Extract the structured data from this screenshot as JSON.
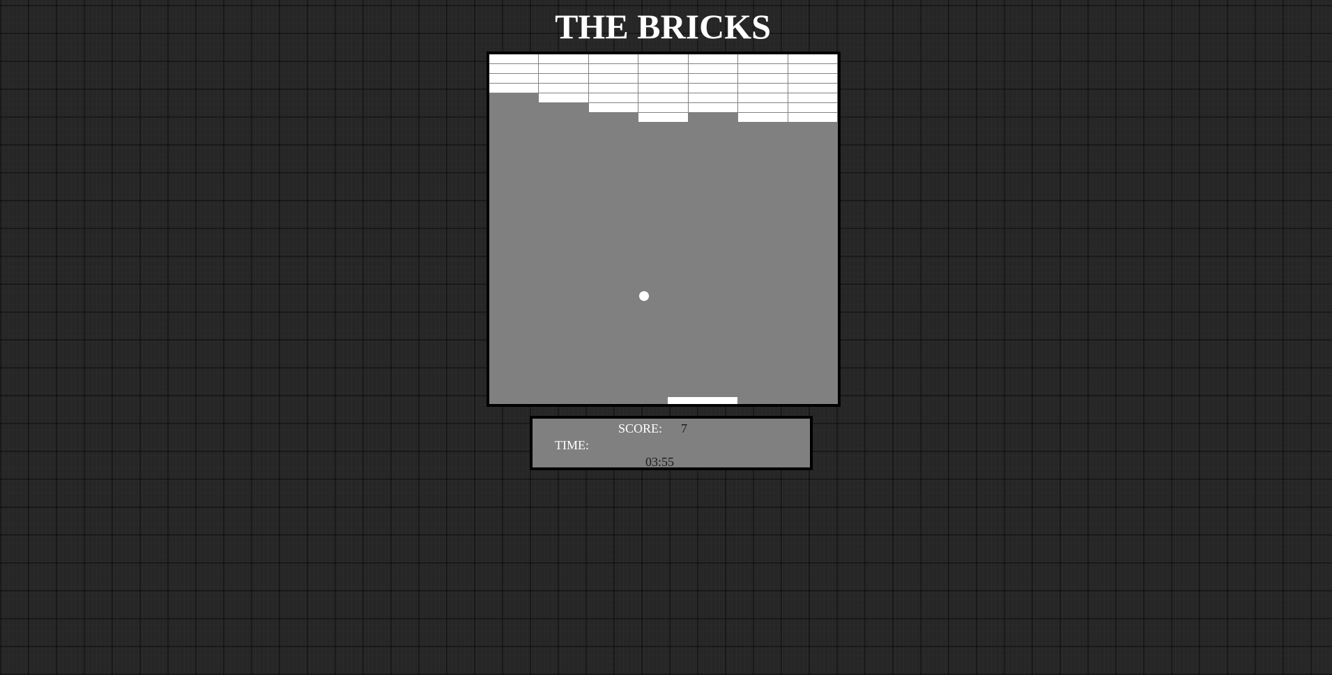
{
  "game": {
    "title": "THE BRICKS"
  },
  "bricks": {
    "columns": 7,
    "rows_remaining_per_column": [
      4,
      5,
      6,
      7,
      6,
      7,
      7
    ],
    "color": "#ffffff",
    "mortar_color": "#808080"
  },
  "board": {
    "background_color": "#808080",
    "border_color": "#000000"
  },
  "ball": {
    "color": "#ffffff"
  },
  "paddle": {
    "color": "#ffffff"
  },
  "scoreboard": {
    "score_label": "SCORE:",
    "score_value": "7",
    "time_label": "TIME:",
    "time_value": "03:55"
  }
}
